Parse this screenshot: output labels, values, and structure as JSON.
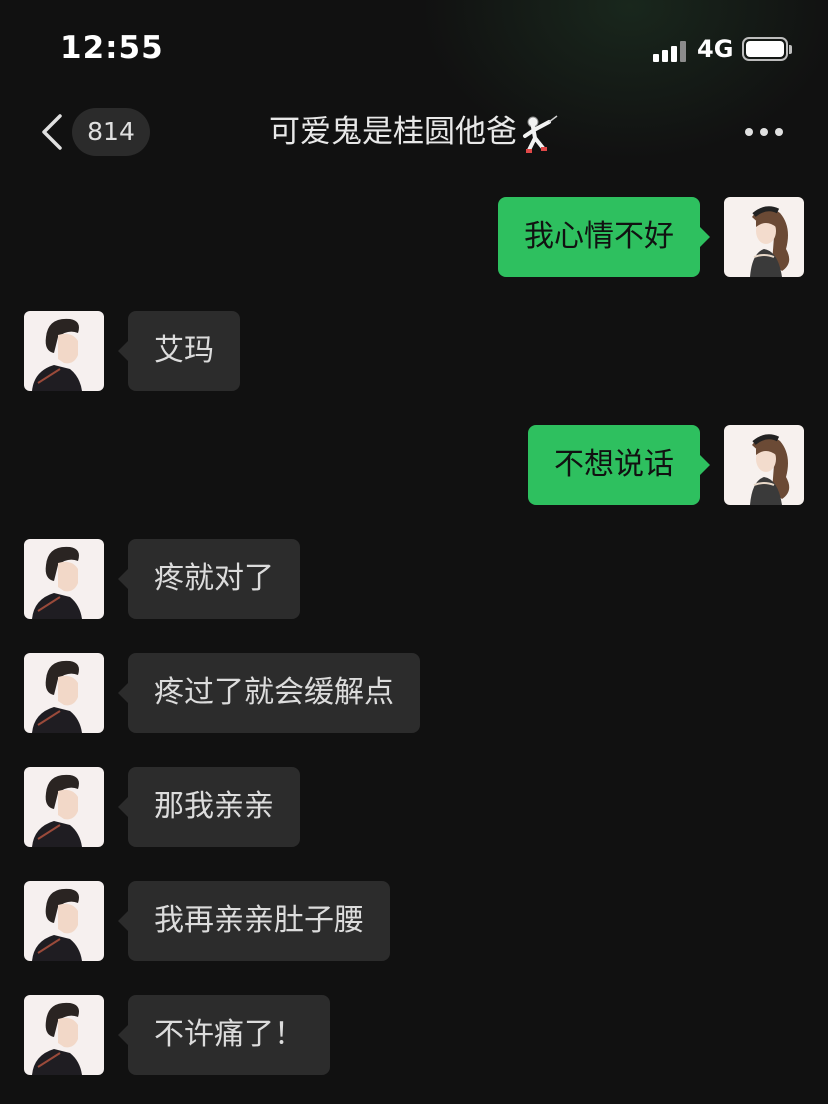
{
  "status_bar": {
    "time": "12:55",
    "network": "4G"
  },
  "header": {
    "unread_count": "814",
    "title": "可爱鬼是桂圆他爸"
  },
  "messages": [
    {
      "direction": "out",
      "text": "我心情不好"
    },
    {
      "direction": "in",
      "text": "艾玛"
    },
    {
      "direction": "out",
      "text": "不想说话"
    },
    {
      "direction": "in",
      "text": "疼就对了"
    },
    {
      "direction": "in",
      "text": "疼过了就会缓解点"
    },
    {
      "direction": "in",
      "text": "那我亲亲"
    },
    {
      "direction": "in",
      "text": "我再亲亲肚子腰"
    },
    {
      "direction": "in",
      "text": "不许痛了！"
    }
  ],
  "icons": {
    "back": "chevron-left-icon",
    "more": "more-dots-icon",
    "title_emoji": "fencer-icon"
  },
  "colors": {
    "background": "#111111",
    "outgoing_bubble": "#2ec05f",
    "incoming_bubble": "#2c2c2c"
  }
}
